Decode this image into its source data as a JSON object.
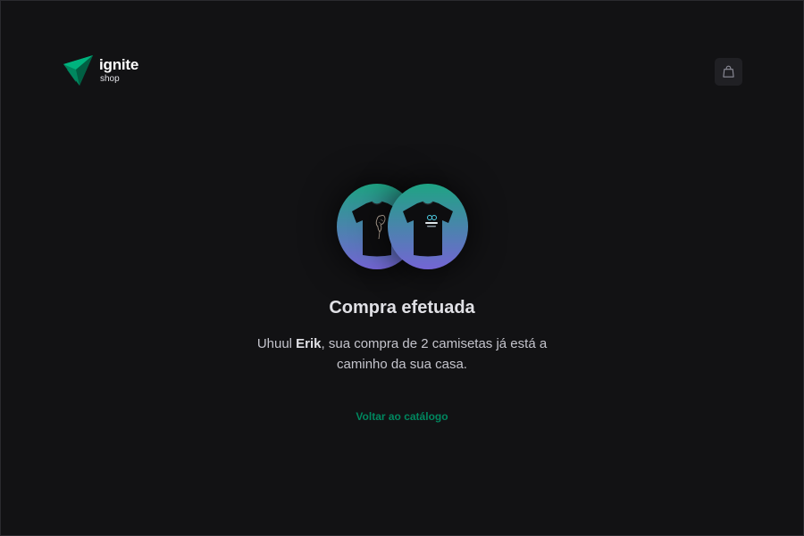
{
  "header": {
    "logo": {
      "title": "ignite",
      "subtitle": "shop"
    },
    "cart": {
      "icon": "shopping-bag-icon"
    }
  },
  "success": {
    "images": [
      {
        "icon": "tshirt-icon",
        "variant": "dark-tshirt-with-print"
      },
      {
        "icon": "tshirt-icon",
        "variant": "dark-tshirt-with-logo"
      }
    ],
    "title": "Compra efetuada",
    "message": {
      "prefix": "Uhuul ",
      "name": "Erik",
      "middle": ", sua compra de ",
      "count": "2",
      "suffix": " camisetas já está a caminho da sua casa."
    },
    "back_link": "Voltar ao catálogo"
  },
  "colors": {
    "background": "#121214",
    "accent": "#00875f",
    "gradient_start": "#1ea483",
    "gradient_end": "#7465d4"
  }
}
